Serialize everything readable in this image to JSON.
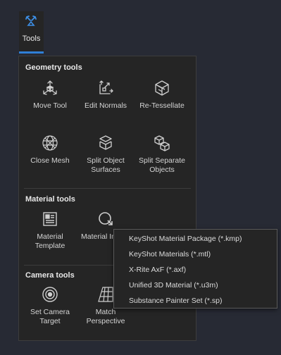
{
  "tab": {
    "label": "Tools"
  },
  "sections": {
    "geometry": {
      "title": "Geometry tools",
      "tools": [
        {
          "label": "Move Tool",
          "icon": "move-tool-icon"
        },
        {
          "label": "Edit Normals",
          "icon": "edit-normals-icon"
        },
        {
          "label": "Re-Tessellate",
          "icon": "re-tessellate-icon"
        },
        {
          "label": "Close Mesh",
          "icon": "close-mesh-icon"
        },
        {
          "label": "Split Object Surfaces",
          "icon": "split-object-surfaces-icon"
        },
        {
          "label": "Split Separate Objects",
          "icon": "split-separate-objects-icon"
        }
      ]
    },
    "material": {
      "title": "Material tools",
      "tools": [
        {
          "label": "Material Template",
          "icon": "material-template-icon"
        },
        {
          "label": "Material Import",
          "icon": "material-import-icon"
        }
      ]
    },
    "camera": {
      "title": "Camera tools",
      "tools": [
        {
          "label": "Set Camera Target",
          "icon": "camera-target-icon"
        },
        {
          "label": "Match Perspective",
          "icon": "match-perspective-icon"
        }
      ]
    }
  },
  "material_import_menu": {
    "items": [
      "KeyShot Material Package (*.kmp)",
      "KeyShot Materials (*.mtl)",
      "X-Rite AxF (*.axf)",
      "Unified 3D Material (*.u3m)",
      "Substance Painter Set (*.sp)"
    ]
  },
  "colors": {
    "background": "#272a34",
    "panel": "#252525",
    "accent": "#2f7fd6",
    "icon": "#cfcfcf"
  }
}
